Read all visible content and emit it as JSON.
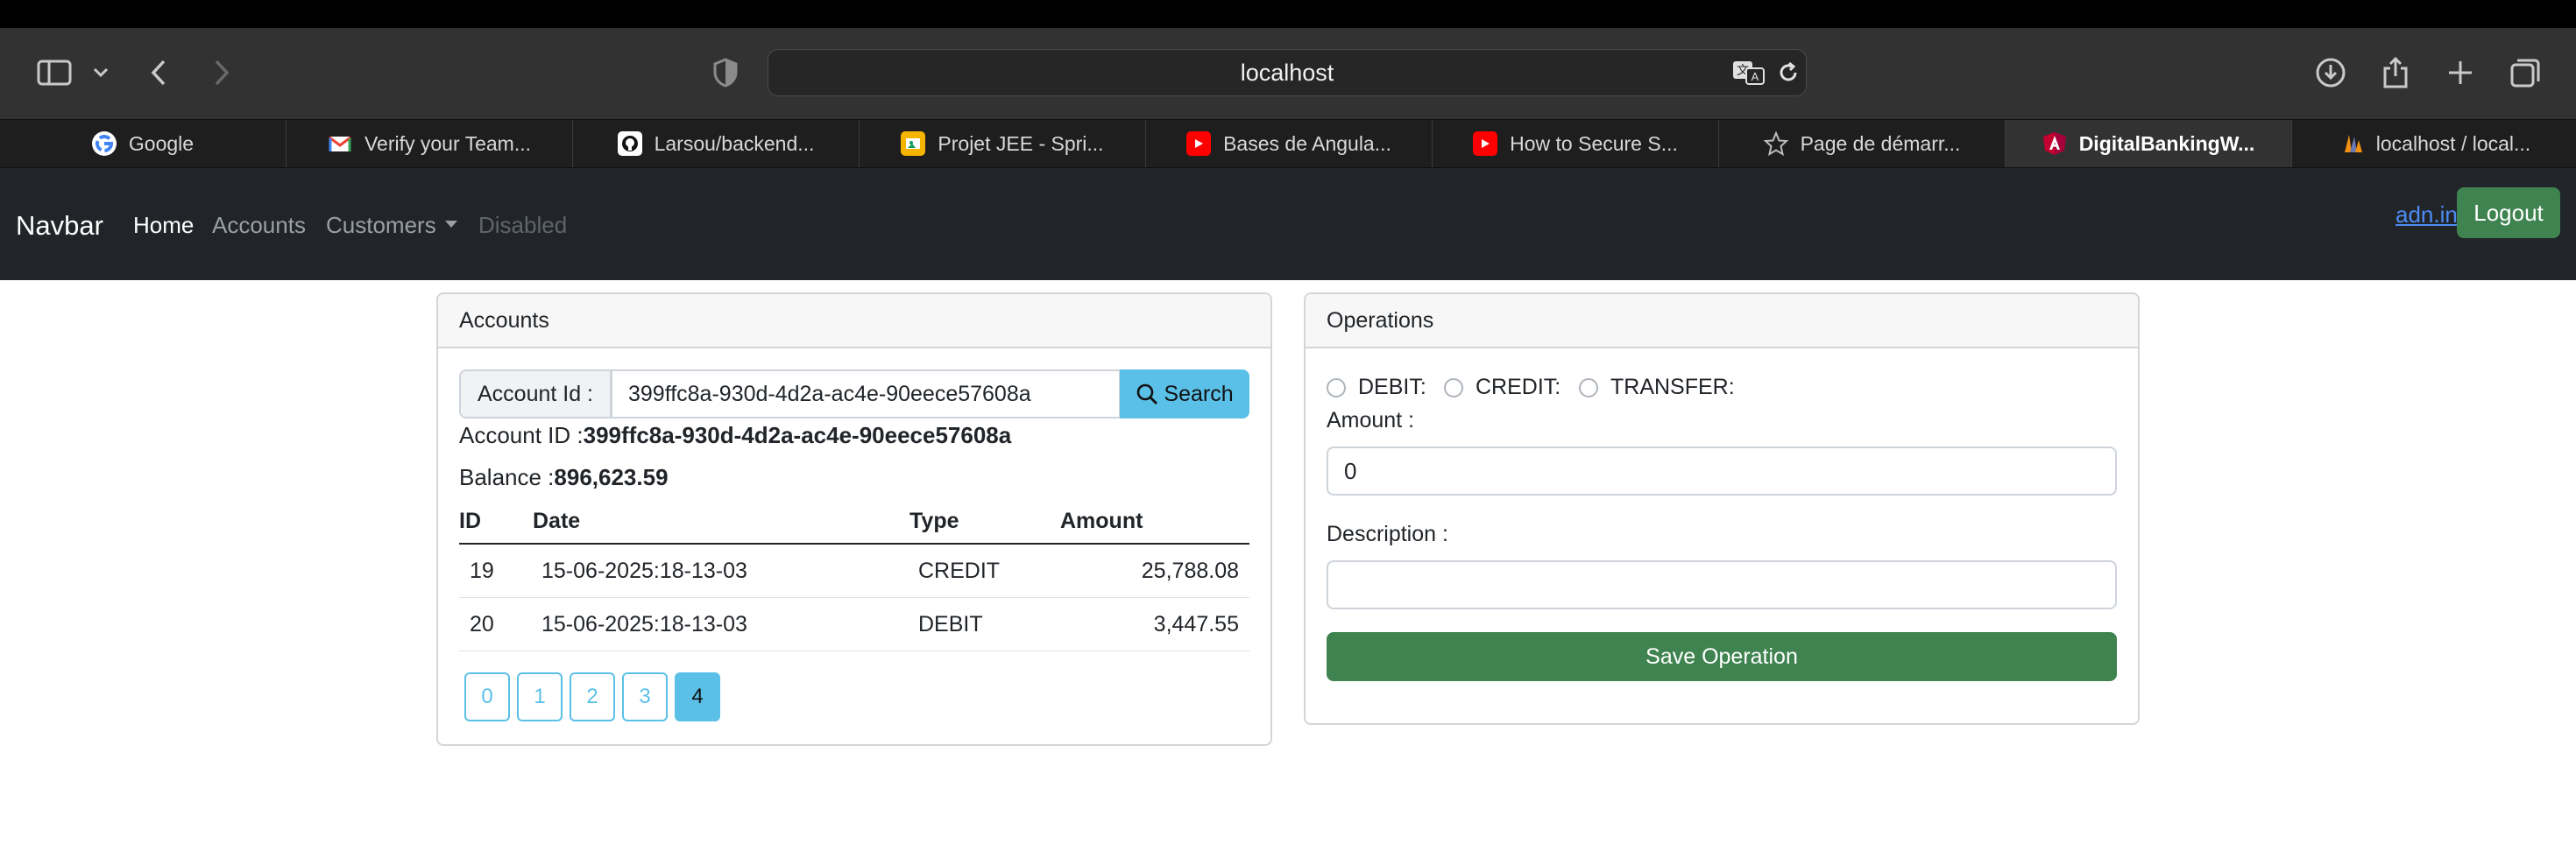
{
  "browser": {
    "url": "localhost",
    "tabs": [
      {
        "label": "Google",
        "icon": "google-icon",
        "active": false
      },
      {
        "label": "Verify your Team...",
        "icon": "gmail-icon",
        "active": false
      },
      {
        "label": "Larsou/backend...",
        "icon": "github-icon",
        "active": false
      },
      {
        "label": "Projet JEE - Spri...",
        "icon": "slides-icon",
        "active": false
      },
      {
        "label": "Bases de Angula...",
        "icon": "youtube-icon",
        "active": false
      },
      {
        "label": "How to Secure S...",
        "icon": "youtube-icon",
        "active": false
      },
      {
        "label": "Page de démarr...",
        "icon": "star-icon",
        "active": false
      },
      {
        "label": "DigitalBankingW...",
        "icon": "angular-icon",
        "active": true
      },
      {
        "label": "localhost / local...",
        "icon": "phpmyadmin-icon",
        "active": false
      }
    ]
  },
  "navbar": {
    "brand": "Navbar",
    "home": "Home",
    "accounts": "Accounts",
    "customers": "Customers",
    "disabled": "Disabled",
    "user": "adn.in",
    "logout": "Logout"
  },
  "accounts_card": {
    "title": "Accounts",
    "search_label": "Account Id :",
    "search_value": "399ffc8a-930d-4d2a-ac4e-90eece57608a",
    "search_button": "Search",
    "account_id_label": "Account ID :",
    "account_id_value": "399ffc8a-930d-4d2a-ac4e-90eece57608a",
    "balance_label": "Balance :",
    "balance_value": "896,623.59",
    "table": {
      "headers": [
        "ID",
        "Date",
        "Type",
        "Amount"
      ],
      "rows": [
        [
          "19",
          "15-06-2025:18-13-03",
          "CREDIT",
          "25,788.08"
        ],
        [
          "20",
          "15-06-2025:18-13-03",
          "DEBIT",
          "3,447.55"
        ]
      ]
    },
    "pages": [
      "0",
      "1",
      "2",
      "3",
      "4"
    ],
    "current_page": "4"
  },
  "operations_card": {
    "title": "Operations",
    "radio_debit": "DEBIT:",
    "radio_credit": "CREDIT:",
    "radio_transfer": "TRANSFER:",
    "amount_label": "Amount :",
    "amount_value": "0",
    "description_label": "Description :",
    "description_value": "",
    "save_button": "Save Operation"
  },
  "colors": {
    "navbar_bg": "#212529",
    "info_button": "#5bc0e8",
    "success_button": "#3f8350"
  }
}
